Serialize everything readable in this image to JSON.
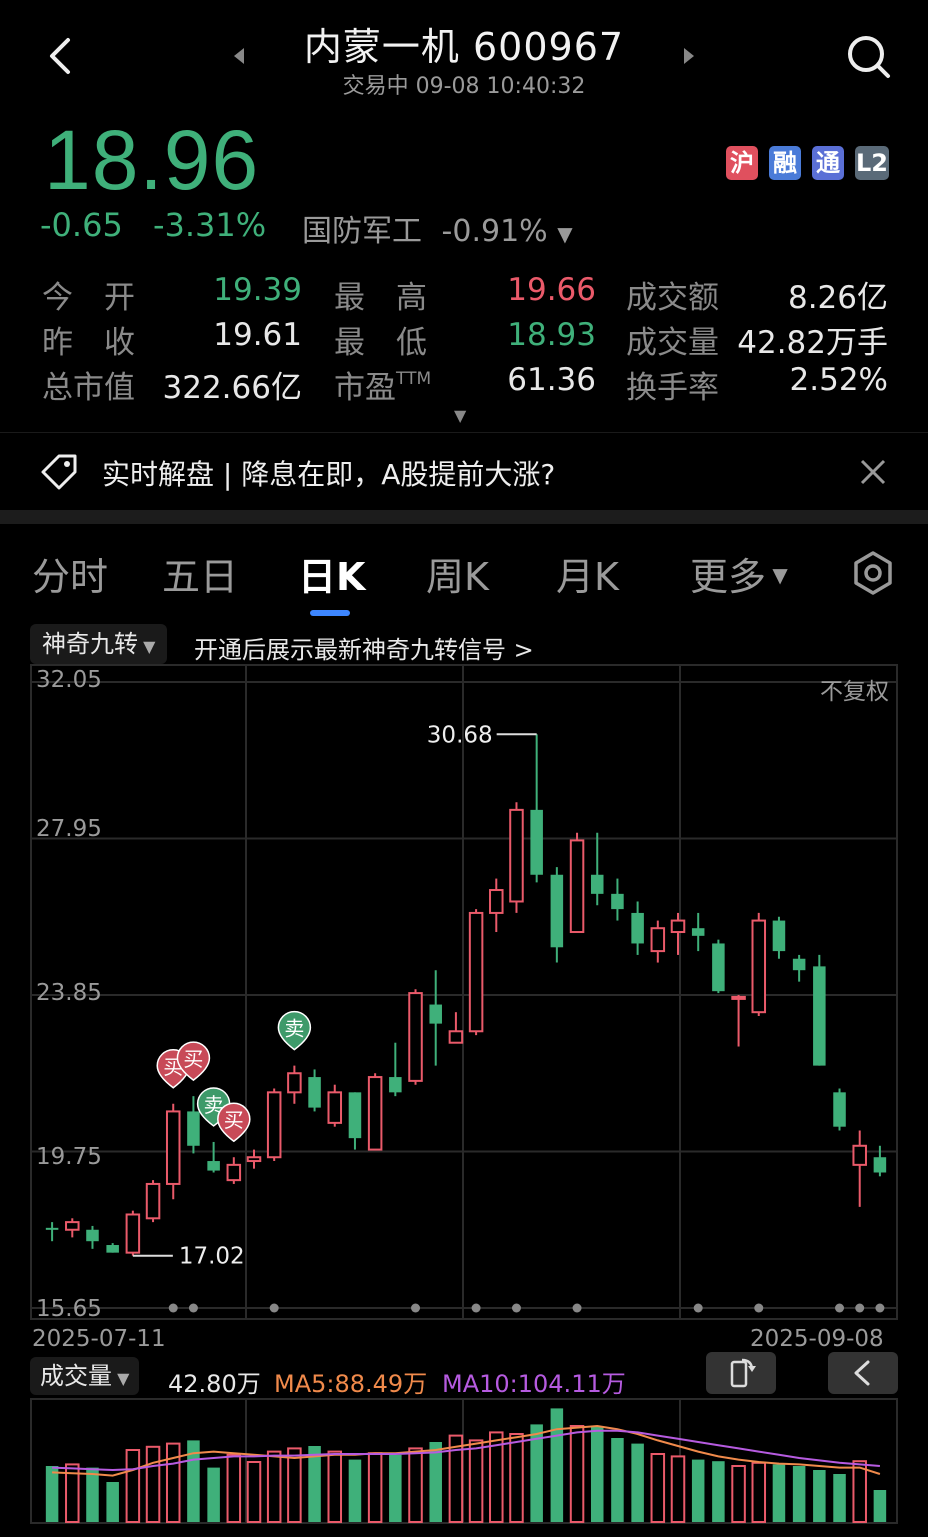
{
  "header": {
    "title": "内蒙一机 600967",
    "status": "交易中 09-08 10:40:32"
  },
  "quote": {
    "price": "18.96",
    "change": "-0.65",
    "change_pct": "-3.31%",
    "sector_name": "国防军工",
    "sector_pct": "-0.91%",
    "badges": [
      "沪",
      "融",
      "通",
      "L2"
    ],
    "fields": [
      {
        "label": "今　开",
        "value": "19.39"
      },
      {
        "label": "最　高",
        "value": "19.66"
      },
      {
        "label": "成交额",
        "value": "8.26亿"
      },
      {
        "label": "昨　收",
        "value": "19.61"
      },
      {
        "label": "最　低",
        "value": "18.93"
      },
      {
        "label": "成交量",
        "value": "42.82万手"
      },
      {
        "label": "总市值",
        "value": "322.66亿"
      },
      {
        "label": "市盈",
        "label_sup": "TTM",
        "value": "61.36"
      },
      {
        "label": "换手率",
        "value": "2.52%"
      }
    ]
  },
  "banner": {
    "text": "实时解盘 | 降息在即，A股提前大涨?"
  },
  "tabs": [
    "分时",
    "五日",
    "日K",
    "周K",
    "月K",
    "更多"
  ],
  "active_tab": "日K",
  "indicator": {
    "name": "神奇九转",
    "hint": "开通后展示最新神奇九转信号 >"
  },
  "colors": {
    "up": "#ea5a6a",
    "down": "#3fb07a",
    "ma5": "#f08a4b",
    "ma10": "#b65be0",
    "accent": "#3d86ff"
  },
  "chart_data": {
    "type": "candlestick",
    "adjust": "不复权",
    "ylim": [
      15.65,
      32.05
    ],
    "yticks": [
      "32.05",
      "27.95",
      "23.85",
      "19.75",
      "15.65"
    ],
    "x_start": "2025-07-11",
    "x_end": "2025-09-08",
    "max_label": "30.68",
    "min_label": "17.02",
    "candles": [
      [
        17.75,
        17.9,
        17.4,
        17.7
      ],
      [
        17.7,
        18.0,
        17.5,
        17.9
      ],
      [
        17.7,
        17.8,
        17.2,
        17.4
      ],
      [
        17.3,
        17.35,
        17.1,
        17.1
      ],
      [
        17.1,
        18.2,
        17.02,
        18.1
      ],
      [
        18.0,
        19.0,
        17.9,
        18.9
      ],
      [
        18.9,
        21.0,
        18.5,
        20.8
      ],
      [
        20.8,
        21.2,
        19.7,
        19.9
      ],
      [
        19.5,
        20.0,
        19.2,
        19.25
      ],
      [
        19.0,
        19.6,
        18.9,
        19.4
      ],
      [
        19.5,
        19.8,
        19.3,
        19.6
      ],
      [
        19.6,
        21.4,
        19.5,
        21.3
      ],
      [
        21.3,
        22.0,
        21.0,
        21.8
      ],
      [
        21.7,
        21.9,
        20.8,
        20.9
      ],
      [
        20.5,
        21.5,
        20.4,
        21.3
      ],
      [
        21.3,
        21.3,
        19.8,
        20.1
      ],
      [
        19.8,
        21.8,
        19.8,
        21.7
      ],
      [
        21.7,
        22.6,
        21.2,
        21.3
      ],
      [
        21.6,
        24.0,
        21.5,
        23.9
      ],
      [
        23.6,
        24.5,
        22.0,
        23.1
      ],
      [
        22.6,
        23.4,
        22.6,
        22.9
      ],
      [
        22.9,
        26.1,
        22.8,
        26.0
      ],
      [
        26.0,
        26.9,
        25.5,
        26.6
      ],
      [
        26.3,
        28.9,
        26.0,
        28.7
      ],
      [
        28.7,
        30.68,
        26.8,
        27.0
      ],
      [
        27.0,
        27.2,
        24.7,
        25.1
      ],
      [
        25.5,
        28.1,
        25.5,
        27.9
      ],
      [
        27.0,
        28.1,
        26.2,
        26.5
      ],
      [
        26.5,
        26.9,
        25.8,
        26.1
      ],
      [
        26.0,
        26.3,
        24.9,
        25.2
      ],
      [
        25.0,
        25.8,
        24.7,
        25.6
      ],
      [
        25.5,
        26.0,
        24.9,
        25.8
      ],
      [
        25.6,
        26.0,
        25.0,
        25.4
      ],
      [
        25.2,
        25.3,
        23.9,
        23.95
      ],
      [
        23.8,
        23.85,
        22.5,
        23.8
      ],
      [
        23.4,
        26.0,
        23.3,
        25.8
      ],
      [
        25.8,
        25.9,
        24.8,
        25.0
      ],
      [
        24.8,
        24.9,
        24.2,
        24.5
      ],
      [
        24.6,
        24.9,
        22.0,
        22.0
      ],
      [
        21.3,
        21.4,
        20.3,
        20.4
      ],
      [
        19.4,
        20.3,
        18.3,
        19.9
      ],
      [
        19.6,
        19.9,
        19.1,
        19.2
      ]
    ],
    "signals": [
      {
        "index": 6,
        "label": "买"
      },
      {
        "index": 7,
        "label": "买"
      },
      {
        "index": 8,
        "label": "卖"
      },
      {
        "index": 9,
        "label": "买"
      },
      {
        "index": 12,
        "label": "卖"
      }
    ],
    "markers": [
      6,
      7,
      11,
      18,
      21,
      23,
      26,
      32,
      35,
      39,
      40,
      41
    ]
  },
  "volume": {
    "label": "成交量",
    "current": "42.80万",
    "ma5": "MA5:88.49万",
    "ma10": "MA10:104.11万",
    "values": [
      70,
      72,
      68,
      50,
      90,
      94,
      98,
      102,
      68,
      84,
      75,
      88,
      92,
      95,
      88,
      78,
      86,
      84,
      92,
      100,
      108,
      102,
      112,
      110,
      122,
      142,
      120,
      120,
      105,
      98,
      85,
      82,
      78,
      76,
      70,
      74,
      72,
      70,
      65,
      60,
      76,
      40
    ],
    "ma5_values": [
      62,
      61,
      60,
      58,
      65,
      74,
      80,
      86,
      88,
      86,
      84,
      82,
      80,
      82,
      84,
      84,
      86,
      86,
      88,
      90,
      94,
      98,
      102,
      106,
      110,
      116,
      118,
      120,
      116,
      110,
      102,
      95,
      88,
      82,
      78,
      75,
      73,
      72,
      70,
      68,
      68,
      60
    ],
    "ma10_values": [
      68,
      67,
      66,
      65,
      66,
      70,
      73,
      78,
      80,
      82,
      82,
      83,
      83,
      84,
      85,
      85,
      85,
      85,
      86,
      87,
      90,
      92,
      96,
      100,
      104,
      108,
      112,
      114,
      114,
      112,
      108,
      104,
      100,
      96,
      92,
      88,
      84,
      80,
      77,
      74,
      72,
      70
    ]
  }
}
